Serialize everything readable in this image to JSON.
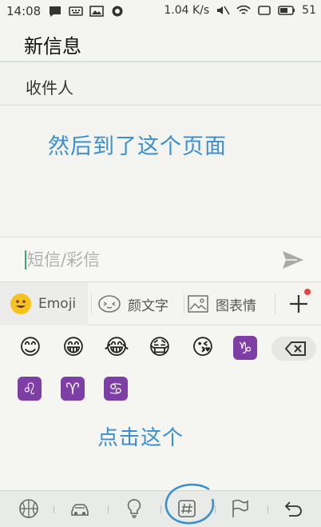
{
  "status": {
    "time": "14:08",
    "speed": "1.04 K/s",
    "battery": "51",
    "left_icons": [
      "message-icon",
      "keyboard-icon",
      "image-icon",
      "app-icon"
    ],
    "right_icons": [
      "mute-icon",
      "wifi-icon",
      "window-icon",
      "battery-icon"
    ]
  },
  "header": {
    "title": "新信息"
  },
  "recipient": {
    "label": "收件人"
  },
  "annotations": {
    "top": "然后到了这个页面",
    "bottom": "点击这个"
  },
  "compose": {
    "placeholder": "短信/彩信"
  },
  "tabs": [
    {
      "label": "Emoji",
      "icon": "smile-emoji-icon"
    },
    {
      "label": "颜文字",
      "icon": "kaomoji-icon"
    },
    {
      "label": "图表情",
      "icon": "picture-sticker-icon"
    }
  ],
  "emoji_rows": [
    [
      "😊",
      "😁",
      "😂",
      "😷",
      "😘",
      "♑"
    ],
    [
      "♌",
      "♈",
      "♋"
    ]
  ],
  "colors": {
    "annotation": "#3a8fd0",
    "accent": "#3aa86a",
    "zodiac": "#7d3fa6",
    "badge": "#e8453c"
  },
  "bottom_bar": [
    "basketball-icon",
    "car-icon",
    "bulb-icon",
    "hashtag-icon",
    "flag-icon",
    "back-icon"
  ]
}
